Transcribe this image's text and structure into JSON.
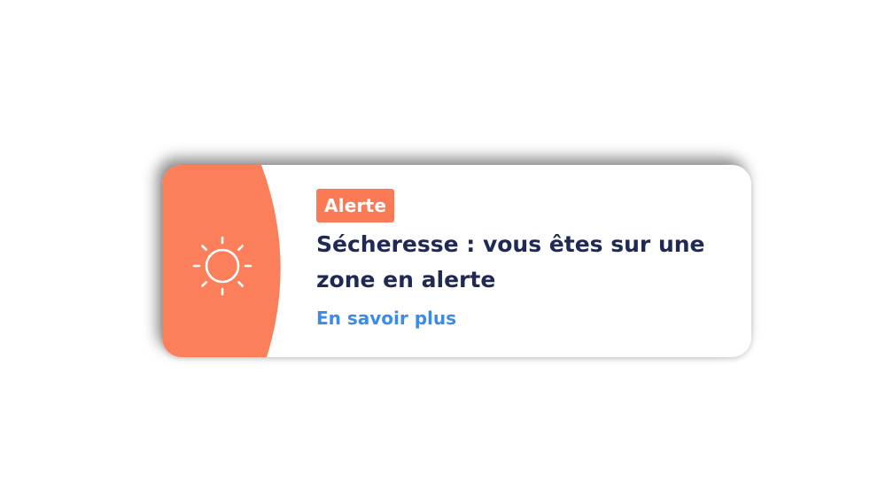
{
  "alert": {
    "badge_label": "Alerte",
    "title": "Sécheresse : vous êtes sur une zone en alerte",
    "link_label": "En savoir plus",
    "icon": "sun-icon"
  },
  "colors": {
    "accent": "#fb7f5a",
    "badge": "#f97a55",
    "title": "#1e2a55",
    "link": "#3b8beb",
    "icon": "#ffffff"
  }
}
